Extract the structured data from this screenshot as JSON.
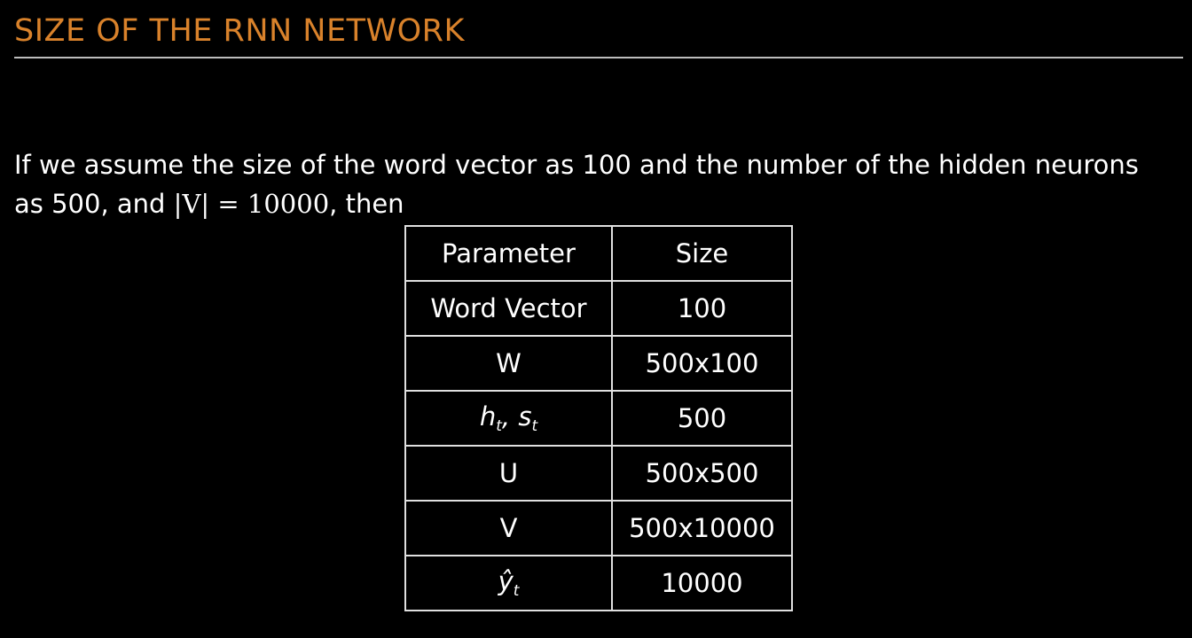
{
  "slide": {
    "title": "SIZE OF THE RNN NETWORK"
  },
  "paragraph": {
    "line1": "If we assume the size of the word vector as 100 and the number of the hidden neurons",
    "line2_prefix": "as 500, and ",
    "line2_math": "|V| = 10000",
    "line2_suffix": ", then"
  },
  "table": {
    "headers": {
      "parameter": "Parameter",
      "size": "Size"
    },
    "rows": [
      {
        "parameter": "Word Vector",
        "size": "100"
      },
      {
        "parameter": "W",
        "size": "500x100"
      },
      {
        "parameter_base1": "h",
        "parameter_sub1": "t",
        "parameter_sep": ", ",
        "parameter_base2": "s",
        "parameter_sub2": "t",
        "size": "500"
      },
      {
        "parameter": "U",
        "size": "500x500"
      },
      {
        "parameter": "V",
        "size": "500x10000"
      },
      {
        "parameter_base": "ŷ",
        "parameter_sub": "t",
        "size": "10000"
      }
    ]
  }
}
